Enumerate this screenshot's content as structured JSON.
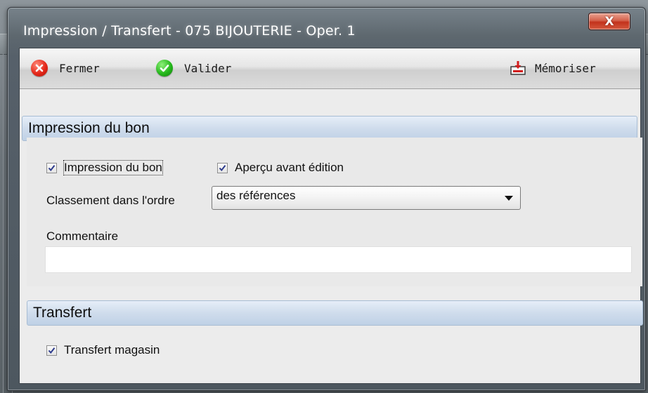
{
  "window": {
    "title": "Impression / Transfert - 075 BIJOUTERIE - Oper. 1",
    "close_glyph": "X"
  },
  "toolbar": {
    "close_label": "Fermer",
    "validate_label": "Valider",
    "save_label": "Mémoriser",
    "icons": {
      "close": "red-x-circle-icon",
      "validate": "green-check-circle-icon",
      "save": "save-to-disk-icon"
    }
  },
  "print_section": {
    "header": "Impression du bon",
    "print_checkbox": {
      "label": "Impression du bon",
      "checked": true
    },
    "preview_checkbox": {
      "label": "Aperçu avant édition",
      "checked": true
    },
    "sort_label": "Classement dans l'ordre",
    "sort_select": {
      "value": "des références"
    },
    "comment_label": "Commentaire",
    "comment_value": ""
  },
  "transfer_section": {
    "header": "Transfert",
    "transfer_checkbox": {
      "label": "Transfert magasin",
      "checked": true
    }
  },
  "colors": {
    "section_header": "#cfdcec",
    "toolbar": "#e0e0e0",
    "close_button": "#c2321c"
  }
}
